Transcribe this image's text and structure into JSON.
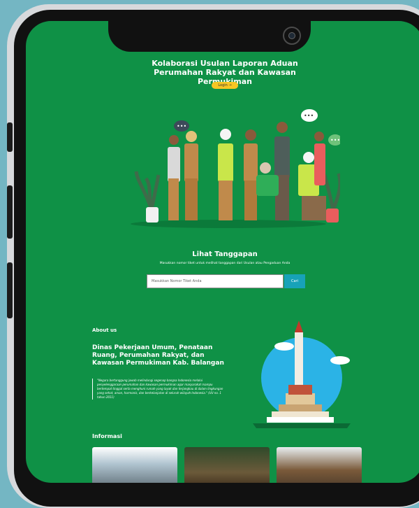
{
  "header": {
    "title": "Kolaborasi Usulan Laporan Aduan Perumahan Rakyat dan Kawasan Permukiman",
    "login_label": "Login"
  },
  "tanggapan": {
    "title": "Lihat Tanggapan",
    "subtitle": "Masukkan nomor tiket untuk melihat tanggapan dari Usulan atau Pengaduan Anda",
    "placeholder": "Masukkan Nomor Tiket Anda",
    "button_label": "Cari"
  },
  "about": {
    "label": "About us",
    "title": "Dinas Pekerjaan Umum, Penataan Ruang, Perumahan Rakyat, dan Kawasan Permukiman Kab. Balangan",
    "quote": "\"Negara bertanggung jawab melindungi segenap bangsa Indonesia melalui penyelenggaraan perumahan dan kawasan permukiman agar masyarakat mampu bertempat tinggal serta menghuni rumah yang layak dan terjangkau di dalam lingkungan yang sehat, aman, harmonis, dan berkelanjutan di seluruh wilayah Indonesia.\" (UU no. 1 tahun 2011)"
  },
  "info": {
    "label": "Informasi"
  },
  "colors": {
    "primary": "#0f9146",
    "accent": "#f6c623",
    "button": "#17a2b8"
  }
}
